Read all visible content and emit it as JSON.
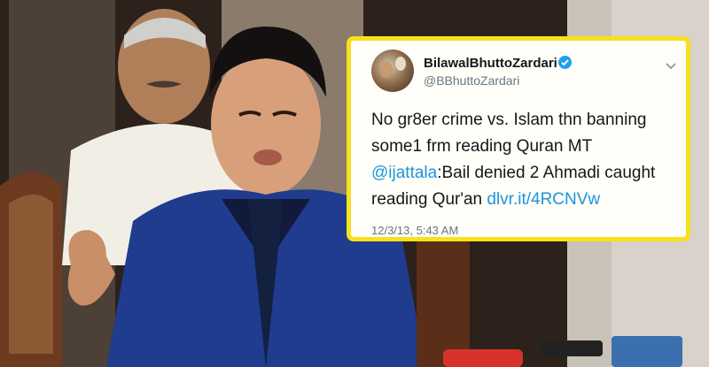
{
  "tweet": {
    "display_name": "BilawalBhuttoZardari",
    "handle": "@BBhuttoZardari",
    "text_part1": "No gr8er crime vs. Islam thn banning some1 frm reading Quran MT ",
    "mention": "@ijattala",
    "text_part2": ":Bail denied 2 Ahmadi caught reading Qur'an ",
    "link": "dlvr.it/4RCNVw",
    "timestamp": "12/3/13, 5:43 AM",
    "verified_icon": "verified-badge-icon",
    "menu_icon": "chevron-down-icon"
  },
  "colors": {
    "border": "#f7e11d",
    "link": "#1b95e0",
    "verified": "#1da1f2",
    "muted": "#657786"
  }
}
